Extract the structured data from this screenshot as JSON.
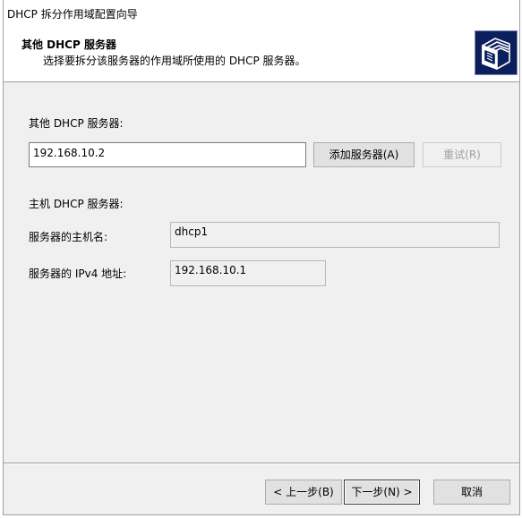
{
  "window": {
    "title": "DHCP 拆分作用域配置向导"
  },
  "header": {
    "title": "其他 DHCP 服务器",
    "subtitle": "选择要拆分该服务器的作用域所使用的 DHCP 服务器。",
    "icon": "wizard-folders-icon"
  },
  "form": {
    "other_server_label": "其他 DHCP 服务器:",
    "other_server_value": "192.168.10.2",
    "add_server_button": "添加服务器(A)",
    "reset_button": "重试(R)",
    "host_section_label": "主机 DHCP 服务器:",
    "host_name_label": "服务器的主机名:",
    "host_name_value": "dhcp1",
    "ipv4_label": "服务器的 IPv4 地址:",
    "ipv4_value": "192.168.10.1"
  },
  "footer": {
    "back_button": "< 上一步(B)",
    "next_button": "下一步(N) >",
    "cancel_button": "取消"
  }
}
